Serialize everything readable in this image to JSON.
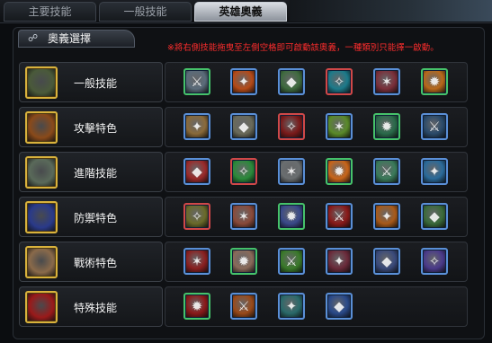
{
  "tabs": [
    {
      "label": "主要技能"
    },
    {
      "label": "一般技能"
    },
    {
      "label": "英雄奧義"
    }
  ],
  "panel": {
    "title": "奧義選擇",
    "notice": "※將右側技能拖曳至左側空格即可啟動該奧義，一種類別只能擇一啟動。"
  },
  "rows": [
    {
      "label": "一般技能",
      "icon": "shield-sword-icon",
      "skills": [
        {
          "icon": "sword-slash-icon",
          "bg": "#5a6b7a"
        },
        {
          "icon": "fire-strike-icon",
          "bg": "#b54a18"
        },
        {
          "icon": "shield-icon",
          "bg": "#3e6a3e"
        },
        {
          "icon": "ice-dash-icon",
          "bg": "#1c7a8a"
        },
        {
          "icon": "blade-streak-icon",
          "bg": "#7a2f3a"
        },
        {
          "icon": "comet-icon",
          "bg": "#b8691a"
        }
      ]
    },
    {
      "label": "攻擊特色",
      "icon": "explosion-icon",
      "skills": [
        {
          "icon": "flex-arm-icon",
          "bg": "#8a6a3a"
        },
        {
          "icon": "alien-head-icon",
          "bg": "#6a6a5a"
        },
        {
          "icon": "demon-eyes-icon",
          "bg": "#7a1a1a"
        },
        {
          "icon": "green-burst-icon",
          "bg": "#5a8a2a"
        },
        {
          "icon": "green-crystal-icon",
          "bg": "#2a6a4a"
        },
        {
          "icon": "hooded-figure-icon",
          "bg": "#2a4a6a"
        }
      ]
    },
    {
      "label": "進階技能",
      "icon": "armored-shield-icon",
      "skills": [
        {
          "icon": "red-claw-icon",
          "bg": "#9a2a2a"
        },
        {
          "icon": "green-swirl-icon",
          "bg": "#2a8a3a"
        },
        {
          "icon": "silver-shield-icon",
          "bg": "#6a6e70"
        },
        {
          "icon": "orange-flame-icon",
          "bg": "#c8651a"
        },
        {
          "icon": "green-arrows-icon",
          "bg": "#3a7a5a"
        },
        {
          "icon": "blue-vortex-icon",
          "bg": "#2a6a9a"
        }
      ]
    },
    {
      "label": "防禦特色",
      "icon": "blue-warrior-icon",
      "skills": [
        {
          "icon": "flexing-hero-icon",
          "bg": "#6a6a2a"
        },
        {
          "icon": "shield-bearer-icon",
          "bg": "#8a4a3a"
        },
        {
          "icon": "blue-runner-icon",
          "bg": "#3a4a8a"
        },
        {
          "icon": "red-guardian-icon",
          "bg": "#8a1a1a"
        },
        {
          "icon": "orange-orbs-icon",
          "bg": "#a85a1a"
        },
        {
          "icon": "green-spiral-icon",
          "bg": "#3a6a3a"
        }
      ]
    },
    {
      "label": "戰術特色",
      "icon": "tactician-icon",
      "skills": [
        {
          "icon": "red-hand-icon",
          "bg": "#8a2020"
        },
        {
          "icon": "star-burst-icon",
          "bg": "#8a6a5a"
        },
        {
          "icon": "green-dash-icon",
          "bg": "#3a7a2a"
        },
        {
          "icon": "red-dancer-icon",
          "bg": "#6a2a3a"
        },
        {
          "icon": "blue-diamond-icon",
          "bg": "#3a4a7a"
        },
        {
          "icon": "violet-arrow-icon",
          "bg": "#4a3a8a"
        }
      ]
    },
    {
      "label": "特殊技能",
      "icon": "red-hero-icon",
      "skills": [
        {
          "icon": "red-strongman-icon",
          "bg": "#8a1a1a"
        },
        {
          "icon": "orange-eye-icon",
          "bg": "#9a4a1a"
        },
        {
          "icon": "teal-lightning-icon",
          "bg": "#2a6a6a"
        },
        {
          "icon": "blue-storm-icon",
          "bg": "#2a4a8a"
        }
      ]
    }
  ]
}
